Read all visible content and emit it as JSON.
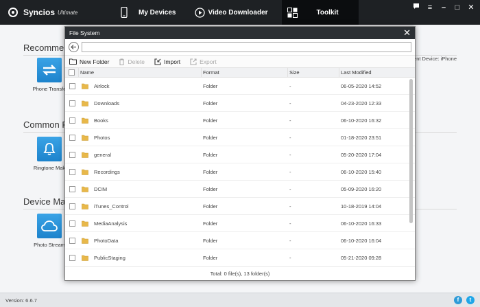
{
  "app": {
    "name": "Syncios",
    "edition": "Ultimate"
  },
  "nav": [
    {
      "label": "My Devices",
      "active": false
    },
    {
      "label": "Video Downloader",
      "active": false
    },
    {
      "label": "Toolkit",
      "active": true
    }
  ],
  "background": {
    "current_device": "ent Device: iPhone",
    "sections": [
      {
        "title": "Recommen",
        "tool_label": "Phone Transfe",
        "tool_icon": "transfer-arrows-icon"
      },
      {
        "title": "Common F",
        "tool_label": "Ringtone Mak",
        "tool_icon": "bell-icon"
      },
      {
        "title": "Device Ma",
        "tool_label": "Photo Stream",
        "tool_icon": "cloud-icon"
      }
    ]
  },
  "dialog": {
    "title": "File System",
    "path_value": "",
    "toolbar": {
      "new_folder": "New Folder",
      "delete": "Delete",
      "import": "Import",
      "export": "Export"
    },
    "columns": {
      "name": "Name",
      "format": "Format",
      "size": "Size",
      "modified": "Last Modified"
    },
    "rows": [
      {
        "name": "Airlock",
        "format": "Folder",
        "size": "-",
        "modified": "06-05-2020 14:52"
      },
      {
        "name": "Downloads",
        "format": "Folder",
        "size": "-",
        "modified": "04-23-2020 12:33"
      },
      {
        "name": "Books",
        "format": "Folder",
        "size": "-",
        "modified": "06-10-2020 16:32"
      },
      {
        "name": "Photos",
        "format": "Folder",
        "size": "-",
        "modified": "01-18-2020 23:51"
      },
      {
        "name": "general",
        "format": "Folder",
        "size": "-",
        "modified": "05-20-2020 17:04"
      },
      {
        "name": "Recordings",
        "format": "Folder",
        "size": "-",
        "modified": "06-10-2020 15:40"
      },
      {
        "name": "DCIM",
        "format": "Folder",
        "size": "-",
        "modified": "05-09-2020 16:20"
      },
      {
        "name": "iTunes_Control",
        "format": "Folder",
        "size": "-",
        "modified": "10-18-2019 14:04"
      },
      {
        "name": "MediaAnalysis",
        "format": "Folder",
        "size": "-",
        "modified": "06-10-2020 16:33"
      },
      {
        "name": "PhotoData",
        "format": "Folder",
        "size": "-",
        "modified": "06-10-2020 16:04"
      },
      {
        "name": "PublicStaging",
        "format": "Folder",
        "size": "-",
        "modified": "05-21-2020 09:28"
      }
    ],
    "footer": "Total: 0 file(s), 13 folder(s)"
  },
  "status": {
    "version": "Version: 6.6.7"
  },
  "colors": {
    "accent": "#1d83cc",
    "topbar": "#1e2124",
    "folder": "#e8b84a"
  }
}
